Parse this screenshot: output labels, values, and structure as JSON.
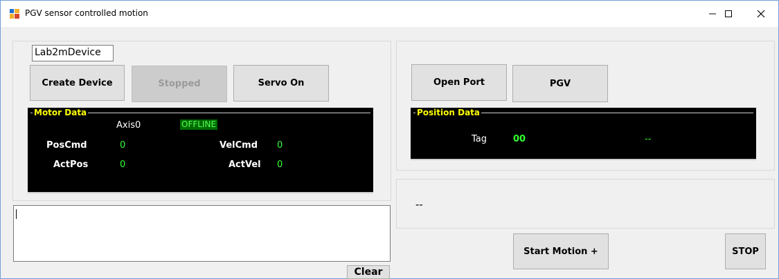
{
  "window": {
    "title": "PGV sensor controlled motion",
    "minimize_glyph": "—",
    "maximize_glyph": "☐",
    "close_glyph": "✕"
  },
  "device_panel": {
    "device_name_value": "Lab2mDevice",
    "create_device_label": "Create Device",
    "stopped_label": "Stopped",
    "servo_on_label": "Servo On"
  },
  "motor_data": {
    "title": "Motor Data",
    "axis_label": "Axis0",
    "status": "OFFLINE",
    "poscmd_label": "PosCmd",
    "poscmd_value": "0",
    "velcmd_label": "VelCmd",
    "velcmd_value": "0",
    "actpos_label": "ActPos",
    "actpos_value": "0",
    "actvel_label": "ActVel",
    "actvel_value": "0"
  },
  "log": {
    "text": "",
    "clear_label": "Clear"
  },
  "port_panel": {
    "open_port_label": "Open Port",
    "pgv_label": "PGV"
  },
  "position_data": {
    "title": "Position Data",
    "tag_label": "Tag",
    "tag_value": "00",
    "extra_value": "--"
  },
  "status_panel": {
    "text": "--"
  },
  "motion": {
    "start_motion_label": "Start Motion +",
    "stop_label": "STOP"
  },
  "colors": {
    "value_green": "#33ff33",
    "group_title_yellow": "#ffff00",
    "offline_bg": "#006b00"
  },
  "icons": {
    "app": "app-window-icon",
    "minimize": "minimize-icon",
    "maximize": "maximize-icon",
    "close": "close-icon"
  }
}
